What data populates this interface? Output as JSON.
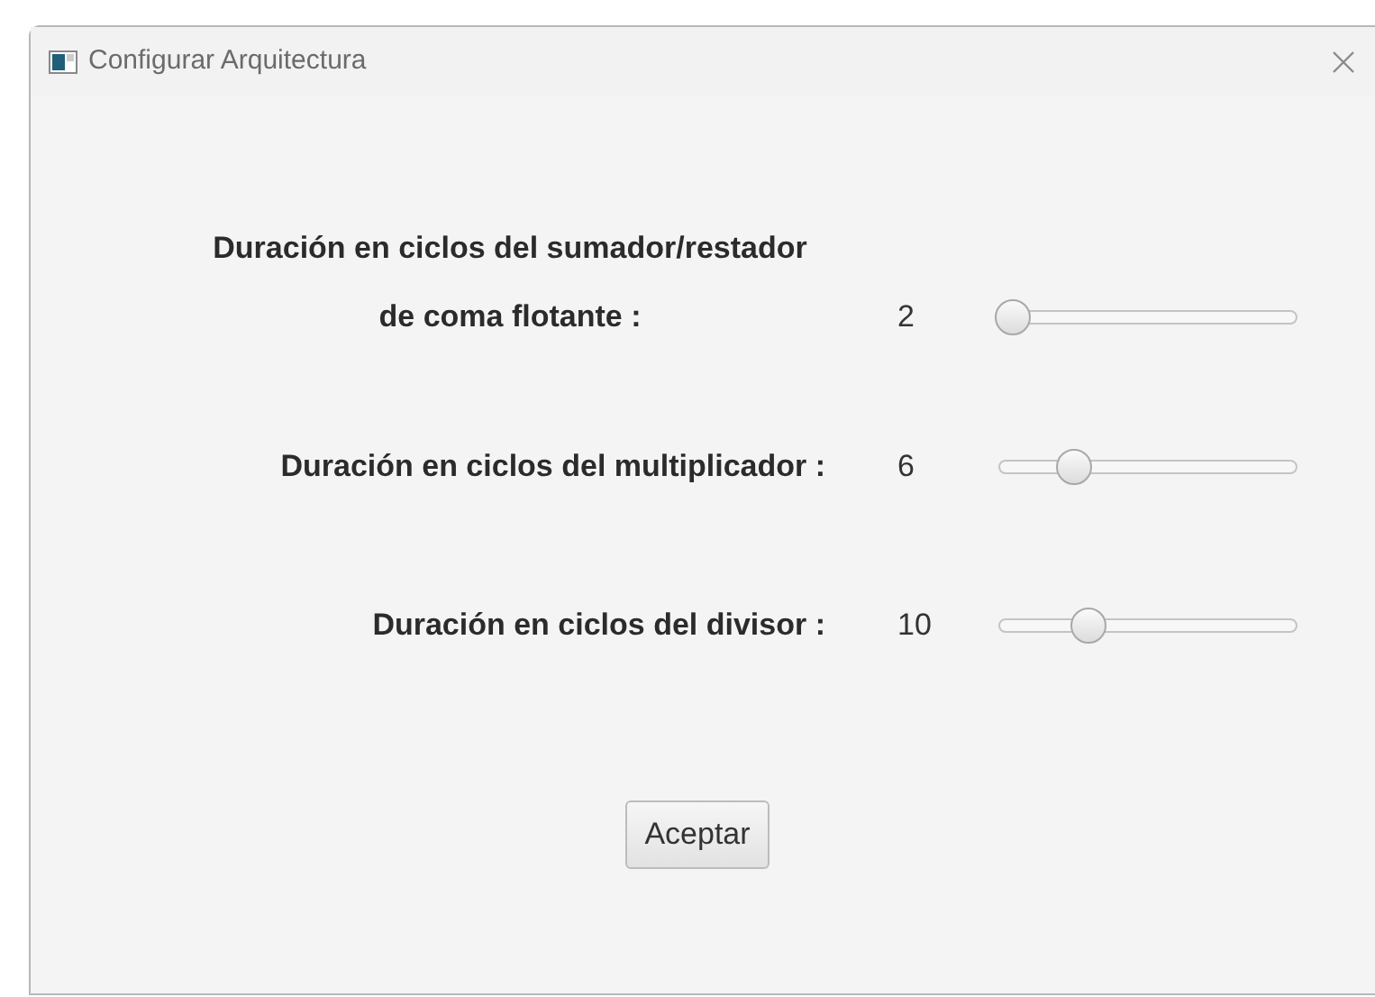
{
  "window": {
    "title": "Configurar Arquitectura"
  },
  "settings": [
    {
      "label": "Duración en ciclos del sumador/restador de coma flotante :",
      "value": "2",
      "level": 0.05
    },
    {
      "label": "Duración en ciclos del multiplicador :",
      "value": "6",
      "level": 0.25
    },
    {
      "label": "Duración en ciclos del divisor :",
      "value": "10",
      "level": 0.3
    }
  ],
  "button": "Aceptar"
}
